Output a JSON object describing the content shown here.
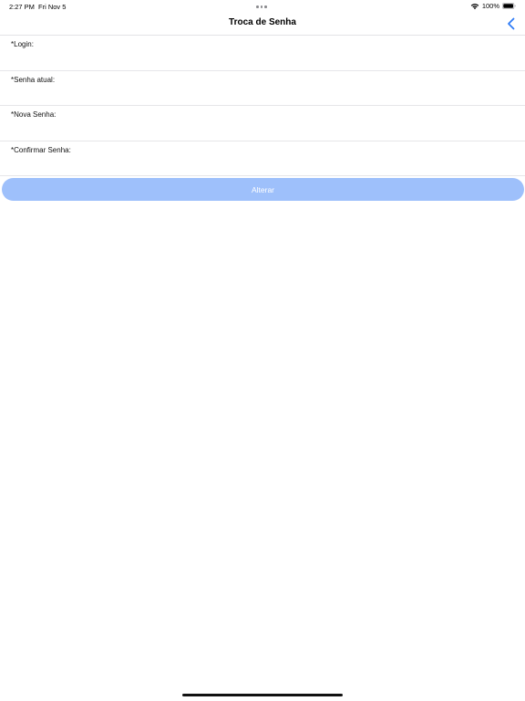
{
  "status_bar": {
    "time": "2:27 PM",
    "date": "Fri Nov 5",
    "battery_percent": "100%",
    "icons": [
      "wifi-icon",
      "battery-icon"
    ]
  },
  "nav": {
    "title": "Troca de Senha",
    "back_icon": "chevron-left-icon",
    "accent_color": "#2f7cf6"
  },
  "form": {
    "fields": [
      {
        "label": "*Login:",
        "value": ""
      },
      {
        "label": "*Senha atual:",
        "value": ""
      },
      {
        "label": "*Nova Senha:",
        "value": ""
      },
      {
        "label": "*Confirmar Senha:",
        "value": ""
      }
    ],
    "submit_label": "Alterar",
    "submit_color": "#9ec0fb"
  }
}
